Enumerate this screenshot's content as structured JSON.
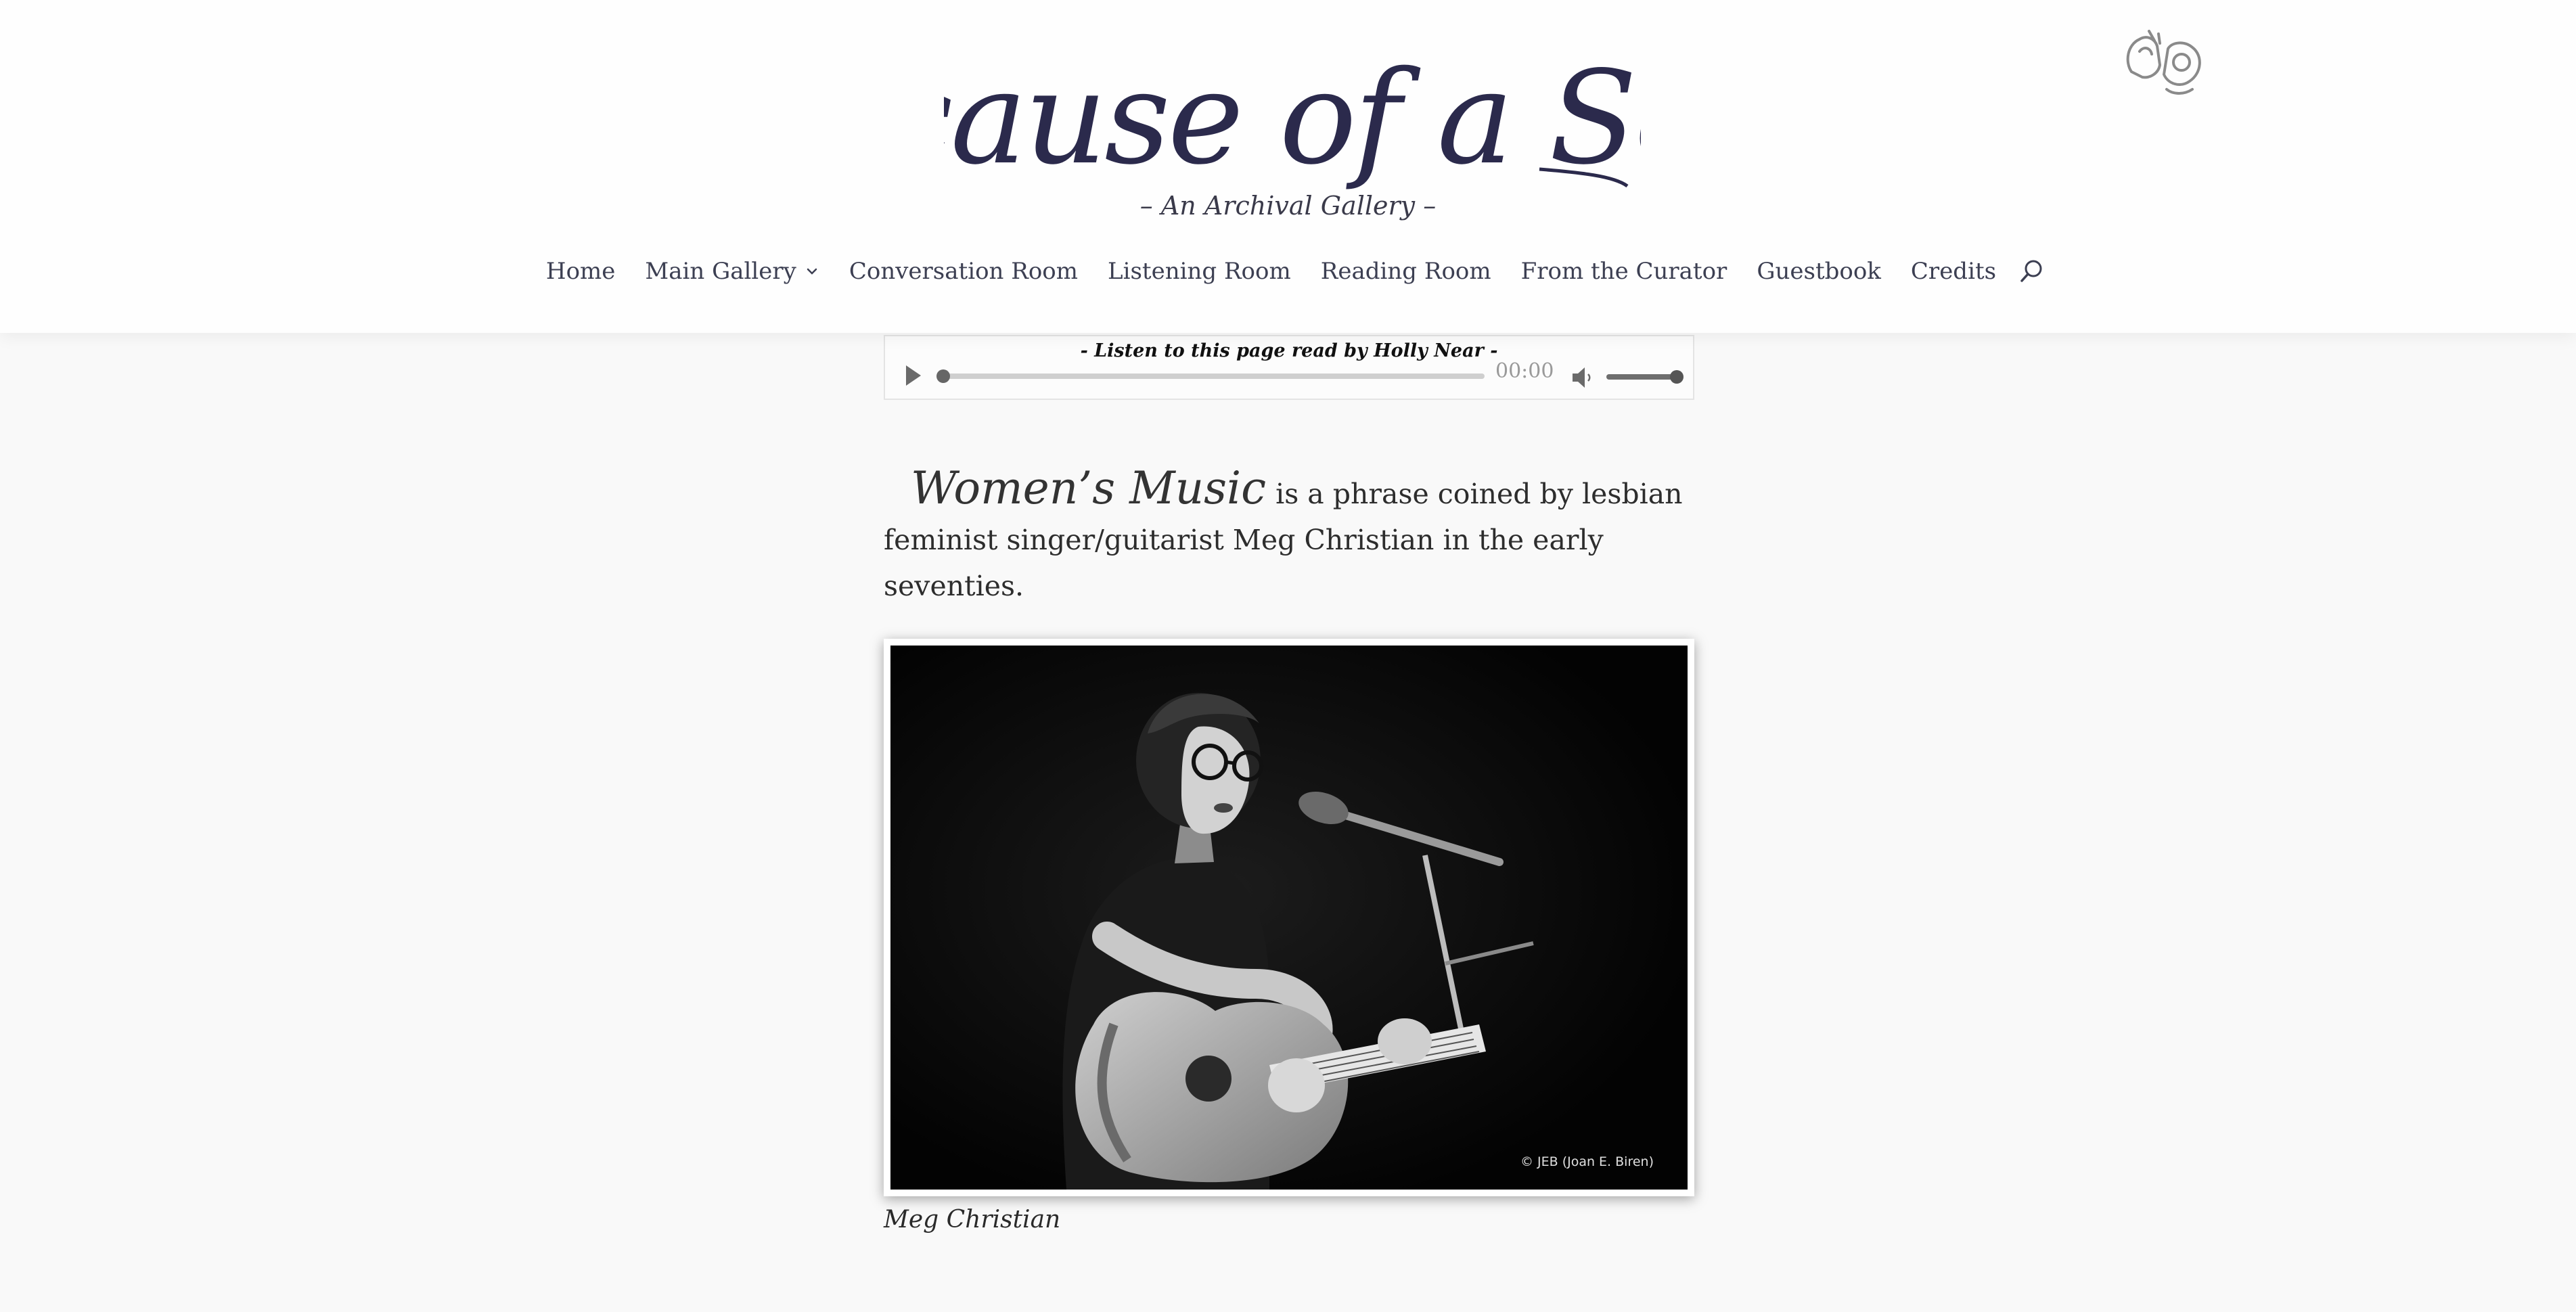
{
  "header": {
    "site_title": "Because of a Song",
    "tagline": "– An Archival Gallery –",
    "title_color": "#2b2a4c",
    "asl_icon": "asl-hands-icon"
  },
  "nav": {
    "items": [
      {
        "label": "Home"
      },
      {
        "label": "Main Gallery",
        "has_dropdown": true
      },
      {
        "label": "Conversation Room"
      },
      {
        "label": "Listening Room"
      },
      {
        "label": "Reading Room"
      },
      {
        "label": "From the Curator"
      },
      {
        "label": "Guestbook"
      },
      {
        "label": "Credits"
      }
    ],
    "search_icon": "search-icon"
  },
  "audio_player": {
    "caption": "- Listen to this page read by Holly Near -",
    "time": "00:00",
    "progress": 0,
    "volume": 1.0,
    "play_icon": "play-icon",
    "volume_icon": "volume-icon"
  },
  "content": {
    "intro_emphasis": "Women’s Music",
    "intro_rest": "is a phrase coined by lesbian feminist singer/guitarist Meg Christian in the early seventies.",
    "photo": {
      "credit": "© JEB (Joan E. Biren)",
      "caption": "Meg Christian"
    }
  }
}
